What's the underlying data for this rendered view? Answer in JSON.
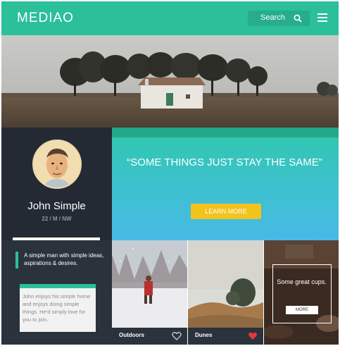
{
  "header": {
    "logo": "MEDIAO",
    "search_label": "Search",
    "search_icon": "magnifier",
    "menu_icon": "hamburger"
  },
  "colors": {
    "brand": "#2bbf9a",
    "accent_button": "#f2c31d",
    "dark_panel": "#232a33",
    "heart_active": "#e53935"
  },
  "profile": {
    "name": "John Simple",
    "meta": "22 / M / NW"
  },
  "quote": {
    "text": "“SOME THINGS JUST STAY THE SAME”",
    "button_label": "LEARN MORE"
  },
  "info": {
    "title": "A simple man with simple ideas, aspirations & desires.",
    "card_text": "John enjoys his simple home and enjoys doing simple things. He'd simply love for you to join."
  },
  "tiles": [
    {
      "label": "Outdoors",
      "icon": "heart-outline",
      "liked": false
    },
    {
      "label": "Dunes",
      "icon": "heart-filled",
      "liked": true
    }
  ],
  "promo": {
    "text": "Some great cups.",
    "button_label": "MORE"
  }
}
